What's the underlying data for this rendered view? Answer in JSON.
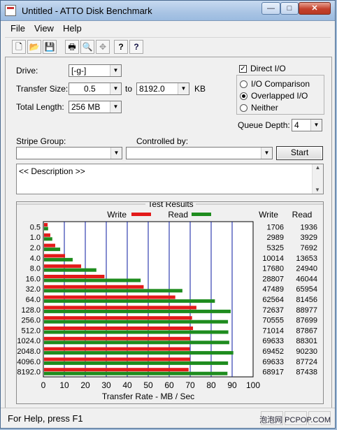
{
  "window": {
    "title": "Untitled - ATTO Disk Benchmark"
  },
  "titlebar": {
    "min_glyph": "—",
    "max_glyph": "□",
    "close_glyph": "✕"
  },
  "menu": [
    "File",
    "View",
    "Help"
  ],
  "toolbar": {
    "icons": [
      "new-file-icon",
      "open-folder-icon",
      "save-disk-icon",
      "print-icon",
      "print-preview-icon",
      "move-icon",
      "help-icon",
      "context-help-icon"
    ],
    "glyphs": [
      "🗋",
      "📂",
      "💾",
      "🖶",
      "🔍",
      "✥",
      "?",
      "?"
    ]
  },
  "settings": {
    "drive_label": "Drive:",
    "drive_value": "[-g-]",
    "transfer_size_label": "Transfer Size:",
    "transfer_from": "0.5",
    "to_label": "to",
    "transfer_to": "8192.0",
    "kb_label": "KB",
    "total_length_label": "Total Length:",
    "total_length_value": "256 MB",
    "direct_io_label": "Direct I/O",
    "direct_io_checked": true,
    "io_comparison_label": "I/O Comparison",
    "overlapped_io_label": "Overlapped I/O",
    "neither_label": "Neither",
    "selected_mode": "Overlapped I/O",
    "queue_depth_label": "Queue Depth:",
    "queue_depth_value": "4",
    "stripe_group_label": "Stripe Group:",
    "controlled_by_label": "Controlled by:",
    "start_button": "Start",
    "description": "<< Description >>"
  },
  "results": {
    "title": "Test Results",
    "legend_write": "Write",
    "legend_read": "Read",
    "col_write": "Write",
    "col_read": "Read",
    "write_color": "#e31a1a",
    "read_color": "#1e8c1e",
    "grid_color": "#0a1aa0",
    "x_label": "Transfer Rate - MB / Sec",
    "x_ticks": [
      "0",
      "10",
      "20",
      "30",
      "40",
      "50",
      "60",
      "70",
      "80",
      "90",
      "100"
    ]
  },
  "chart_data": {
    "type": "bar",
    "orientation": "horizontal",
    "categories": [
      "0.5",
      "1.0",
      "2.0",
      "4.0",
      "8.0",
      "16.0",
      "32.0",
      "64.0",
      "128.0",
      "256.0",
      "512.0",
      "1024.0",
      "2048.0",
      "4096.0",
      "8192.0"
    ],
    "series": [
      {
        "name": "Write",
        "values": [
          1706,
          2989,
          5325,
          10014,
          17680,
          28807,
          47489,
          62564,
          72637,
          70555,
          71014,
          69633,
          69452,
          69633,
          68917
        ]
      },
      {
        "name": "Read",
        "values": [
          1936,
          3929,
          7692,
          13653,
          24940,
          46044,
          65954,
          81456,
          88977,
          87699,
          87867,
          88301,
          90230,
          87724,
          87438
        ]
      }
    ],
    "xlabel": "Transfer Rate - MB / Sec",
    "xlim": [
      0,
      100
    ]
  },
  "status": {
    "text": "For Help, press F1",
    "watermark": "泡泡网  PCPOP.COM"
  }
}
